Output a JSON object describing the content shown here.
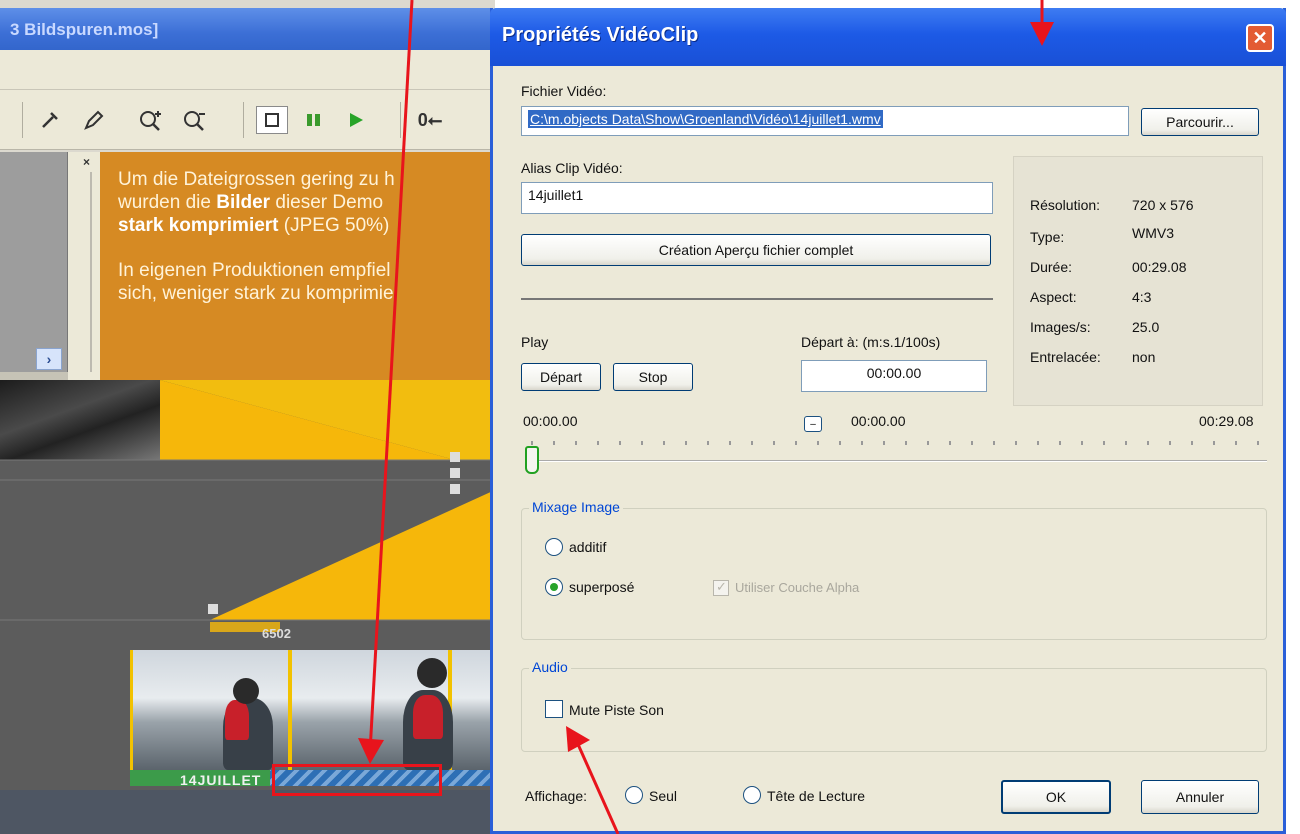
{
  "app": {
    "title": "3 Bildspuren.mos]",
    "toolbar_counter": "0⭠",
    "info_text": {
      "line1": "Um die Dateigrossen gering zu h",
      "line2_a": "wurden die ",
      "line2_b": "Bilder",
      "line2_c": " dieser Demo",
      "line3_a": "stark komprimiert",
      "line3_b": " (JPEG 50%)",
      "line4": "In eigenen Produktionen empfiel",
      "line5": "sich, weniger stark zu komprimie"
    },
    "timeline": {
      "lane_label": "6502",
      "clip_label": "14JUILLET"
    }
  },
  "dialog": {
    "title": "Propriétés VidéoClip",
    "close_icon": "close-icon",
    "fichier_video_label": "Fichier Vidéo:",
    "fichier_video_value": "C:\\m.objects Data\\Show\\Groenland\\Vidéo\\14juillet1.wmv",
    "browse_button": "Parcourir...",
    "alias_label": "Alias Clip Vidéo:",
    "alias_value": "14juillet1",
    "preview_button": "Création Aperçu fichier complet",
    "info": {
      "resolution_label": "Résolution:",
      "resolution_value": "720 x 576",
      "type_label": "Type:",
      "type_value": "WMV3",
      "duree_label": "Durée:",
      "duree_value": "00:29.08",
      "aspect_label": "Aspect:",
      "aspect_value": "4:3",
      "images_label": "Images/s:",
      "images_value": "25.0",
      "entrelacee_label": "Entrelacée:",
      "entrelacee_value": "non"
    },
    "play_label": "Play",
    "depart_button": "Départ",
    "stop_button": "Stop",
    "depart_a_label": "Départ à: (m:s.1/100s)",
    "depart_a_value": "00:00.00",
    "slider_start": "00:00.00",
    "slider_current": "00:00.00",
    "slider_end": "00:29.08",
    "mixage_group": "Mixage Image",
    "additif_label": "additif",
    "superpose_label": "superposé",
    "alpha_label": "Utiliser Couche Alpha",
    "audio_group": "Audio",
    "mute_label": "Mute Piste Son",
    "affichage_label": "Affichage:",
    "seul_label": "Seul",
    "tete_label": "Tête de Lecture",
    "ok_button": "OK",
    "cancel_button": "Annuler"
  },
  "colors": {
    "annotation_red": "#e8141c",
    "xp_title_blue": "#1d5ae6",
    "info_panel_orange": "#d68a23"
  }
}
